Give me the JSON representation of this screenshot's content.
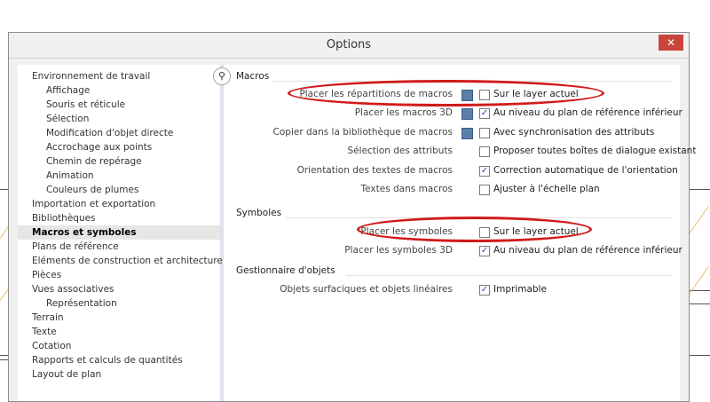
{
  "window": {
    "title": "Options",
    "close_symbol": "✕"
  },
  "sidebar": {
    "items": [
      {
        "label": "Environnement de travail",
        "level": 0
      },
      {
        "label": "Affichage",
        "level": 1
      },
      {
        "label": "Souris et réticule",
        "level": 1
      },
      {
        "label": "Sélection",
        "level": 1
      },
      {
        "label": "Modification d'objet directe",
        "level": 1
      },
      {
        "label": "Accrochage aux points",
        "level": 1
      },
      {
        "label": "Chemin de repérage",
        "level": 1
      },
      {
        "label": "Animation",
        "level": 1
      },
      {
        "label": "Couleurs de plumes",
        "level": 1
      },
      {
        "label": "Importation et exportation",
        "level": 0
      },
      {
        "label": "Bibliothèques",
        "level": 0
      },
      {
        "label": "Macros et symboles",
        "level": 0,
        "selected": true
      },
      {
        "label": "Plans de référence",
        "level": 0
      },
      {
        "label": "Eléments de construction et architecture",
        "level": 0
      },
      {
        "label": "Pièces",
        "level": 0
      },
      {
        "label": "Vues associatives",
        "level": 0
      },
      {
        "label": "Représentation",
        "level": 1
      },
      {
        "label": "Terrain",
        "level": 0
      },
      {
        "label": "Texte",
        "level": 0
      },
      {
        "label": "Cotation",
        "level": 0
      },
      {
        "label": "Rapports et calculs de quantités",
        "level": 0
      },
      {
        "label": "Layout de plan",
        "level": 0
      }
    ]
  },
  "sections": {
    "macros": {
      "title": "Macros",
      "rows": [
        {
          "label": "Placer les répartitions de macros",
          "info": true,
          "checked": false,
          "value": "Sur le layer actuel"
        },
        {
          "label": "Placer les macros 3D",
          "info": true,
          "checked": true,
          "value": "Au  niveau du plan de référence inférieur"
        },
        {
          "label": "Copier dans la bibliothèque de macros",
          "info": true,
          "checked": false,
          "value": "Avec synchronisation des attributs"
        },
        {
          "label": "Sélection des attributs",
          "info": false,
          "checked": false,
          "value": "Proposer toutes boîtes de dialogue existant"
        },
        {
          "label": "Orientation des textes de macros",
          "info": false,
          "checked": true,
          "value": "Correction automatique de l'orientation"
        },
        {
          "label": "Textes dans macros",
          "info": false,
          "checked": false,
          "value": "Ajuster à l'échelle plan"
        }
      ]
    },
    "symboles": {
      "title": "Symboles",
      "rows": [
        {
          "label": "Placer les symboles",
          "info": false,
          "checked": false,
          "value": "Sur le layer actuel"
        },
        {
          "label": "Placer les symboles 3D",
          "info": false,
          "checked": true,
          "value": "Au niveau du plan de référence inférieur"
        }
      ]
    },
    "gestionnaire": {
      "title": "Gestionnaire d'objets",
      "rows": [
        {
          "label": "Objets surfaciques et objets linéaires",
          "info": false,
          "checked": true,
          "value": "Imprimable"
        }
      ]
    }
  },
  "colors": {
    "accent_close": "#c9453b",
    "highlight_ellipse": "#d11a1a",
    "checkbox_mark": "#2a4f9a"
  }
}
